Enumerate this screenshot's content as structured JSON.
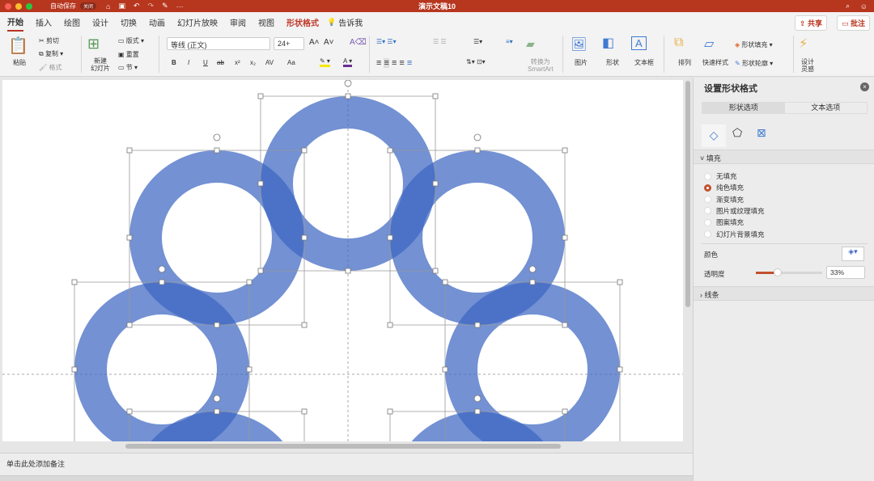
{
  "titlebar": {
    "title": "演示文稿10",
    "autosave_label": "自动保存",
    "autosave_state": "关闭",
    "more": "···"
  },
  "tabs": [
    {
      "label": "开始"
    },
    {
      "label": "插入"
    },
    {
      "label": "绘图"
    },
    {
      "label": "设计"
    },
    {
      "label": "切换"
    },
    {
      "label": "动画"
    },
    {
      "label": "幻灯片放映"
    },
    {
      "label": "审阅"
    },
    {
      "label": "视图"
    },
    {
      "label": "形状格式"
    },
    {
      "label": "告诉我"
    }
  ],
  "header_buttons": {
    "share": "共享",
    "comments": "批注"
  },
  "ribbon": {
    "paste": "粘贴",
    "cut": "剪切",
    "copy": "复制",
    "format": "格式",
    "new_slide": "新建",
    "new_slide2": "幻灯片",
    "layout": "版式",
    "reset": "重置",
    "section": "节",
    "font_name": "等线 (正文)",
    "font_size": "24+",
    "bold": "B",
    "italic": "I",
    "underline": "U",
    "strike": "ab",
    "superscript": "x²",
    "subscript": "x₂",
    "spacing": "AV",
    "case": "Aa",
    "convert_smartart": "转换为",
    "smartart": "SmartArt",
    "picture": "图片",
    "shape": "形状",
    "textbox": "文本框",
    "arrange": "排列",
    "quick_styles": "快速样式",
    "shape_fill": "形状填充",
    "shape_outline": "形状轮廓",
    "designer": "设计",
    "designer2": "灵感"
  },
  "notes": {
    "placeholder": "单击此处添加备注"
  },
  "pane": {
    "title": "设置形状格式",
    "tabs": [
      {
        "label": "形状选项"
      },
      {
        "label": "文本选项"
      }
    ],
    "fill_section": "填充",
    "fill_options": [
      {
        "label": "无填充",
        "selected": false
      },
      {
        "label": "纯色填充",
        "selected": true
      },
      {
        "label": "渐变填充",
        "selected": false
      },
      {
        "label": "图片或纹理填充",
        "selected": false
      },
      {
        "label": "图案填充",
        "selected": false
      },
      {
        "label": "幻灯片背景填充",
        "selected": false
      }
    ],
    "color_label": "颜色",
    "transparency_label": "透明度",
    "transparency_value": "33%",
    "transparency_fraction": 0.33,
    "line_section": "线条"
  },
  "colors": {
    "accent": "#b7361e",
    "ring": "#3d67c2"
  }
}
